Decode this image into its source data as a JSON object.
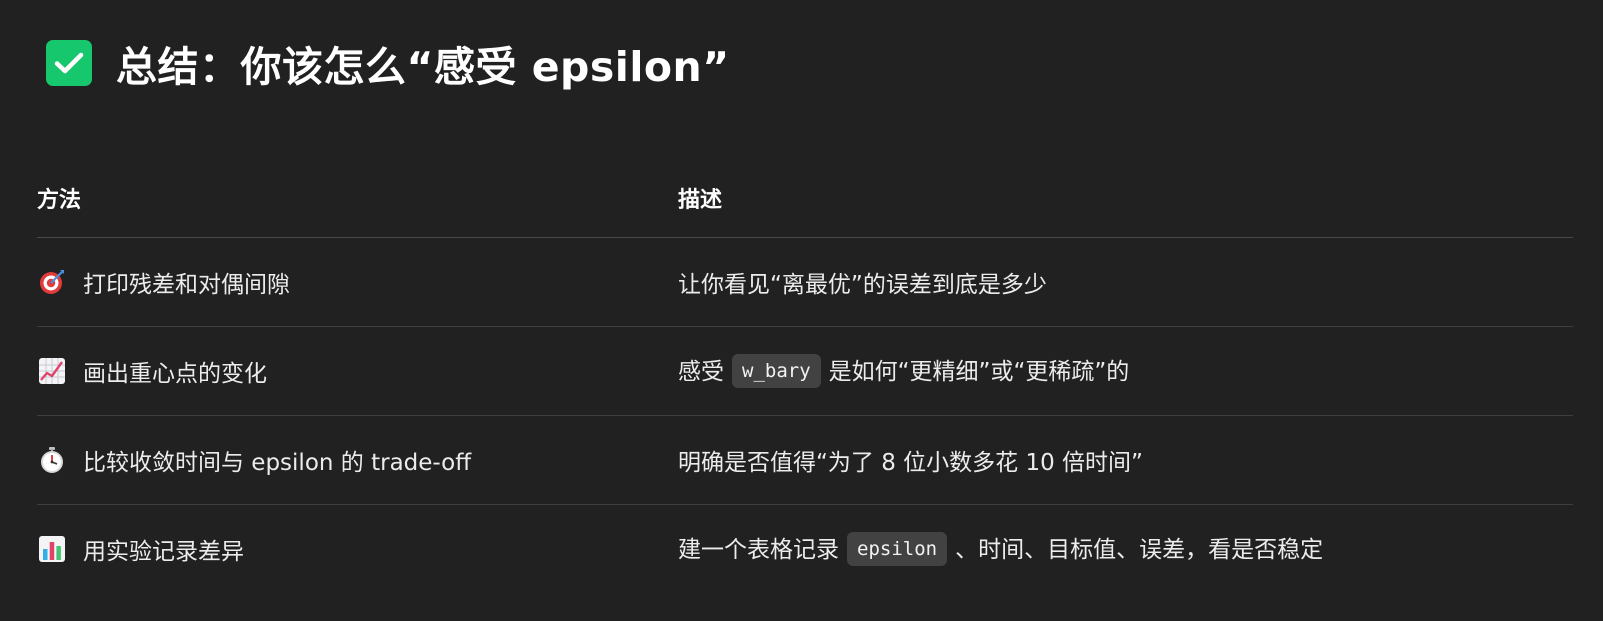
{
  "heading": {
    "icon": "check-mark-box-icon",
    "title": "总结：你该怎么“感受 epsilon”",
    "accent_color": "#17c76d"
  },
  "table": {
    "headers": {
      "method": "方法",
      "description": "描述"
    },
    "rows": [
      {
        "icon": "target-icon",
        "method": "打印残差和对偶间隙",
        "desc_before": "让你看见“离最优”的误差到底是多少",
        "code": "",
        "desc_after": ""
      },
      {
        "icon": "chart-increasing-icon",
        "method": "画出重心点的变化",
        "desc_before": "感受",
        "code": "w_bary",
        "desc_after": "是如何“更精细”或“更稀疏”的"
      },
      {
        "icon": "stopwatch-icon",
        "method": "比较收敛时间与 epsilon 的 trade-off",
        "desc_before": "明确是否值得“为了 8 位小数多花 10 倍时间”",
        "code": "",
        "desc_after": ""
      },
      {
        "icon": "bar-chart-icon",
        "method": "用实验记录差异",
        "desc_before": "建一个表格记录",
        "code": "epsilon",
        "desc_after": "、时间、目标值、误差，看是否稳定"
      }
    ]
  }
}
